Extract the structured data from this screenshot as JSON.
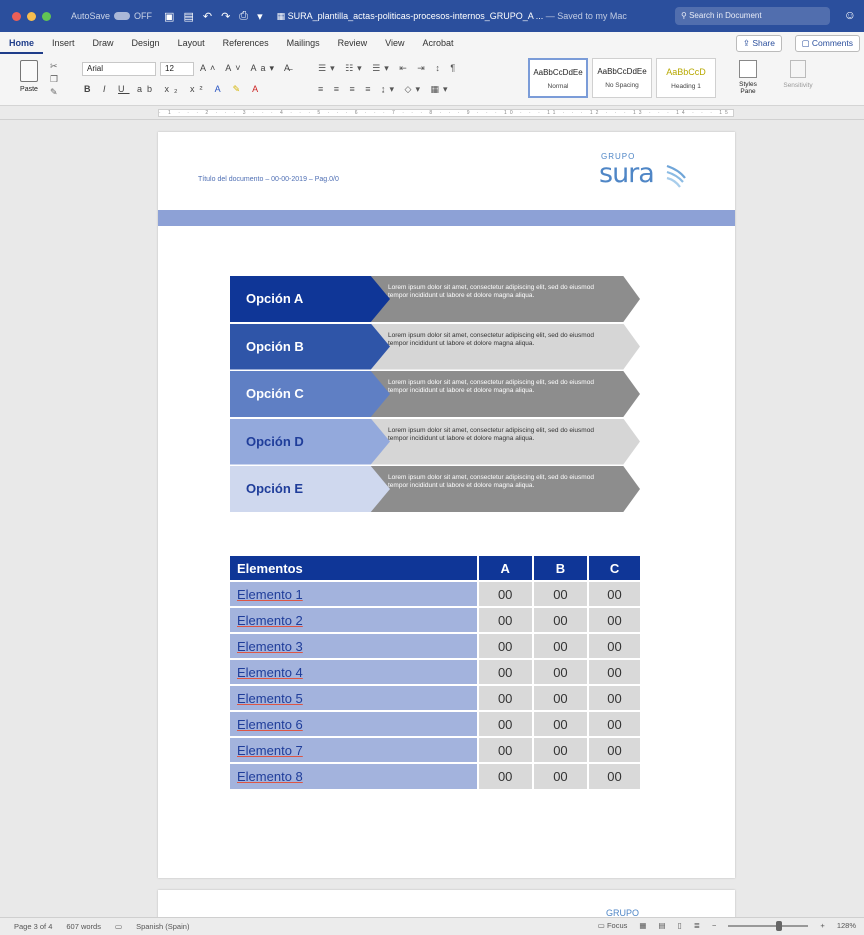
{
  "app": {
    "autosave_label": "AutoSave",
    "autosave_state": "OFF",
    "doc_title": "SURA_plantilla_actas-politicas-procesos-internos_GRUPO_A",
    "saved_status": "— Saved to my Mac",
    "search_placeholder": "Search in Document"
  },
  "tabs": [
    "Home",
    "Insert",
    "Draw",
    "Design",
    "Layout",
    "References",
    "Mailings",
    "Review",
    "View",
    "Acrobat"
  ],
  "share_label": "Share",
  "comments_label": "Comments",
  "ribbon": {
    "paste_label": "Paste",
    "font_name": "Arial",
    "font_size": "12",
    "styles": [
      {
        "sample": "AaBbCcDdEe",
        "name": "Normal"
      },
      {
        "sample": "AaBbCcDdEe",
        "name": "No Spacing"
      },
      {
        "sample": "AaBbCcD",
        "name": "Heading 1"
      }
    ],
    "styles_pane_label": "Styles Pane",
    "sensitivity_label": "Sensitivity"
  },
  "document": {
    "header_text": "Título del documento – 00-00-2019 – Pag.0/0",
    "logo_grupo": "GRUPO",
    "logo_sura": "sura",
    "options": [
      {
        "label": "Opción A",
        "text": "Lorem ipsum dolor sit amet, consectetur adipiscing elit, sed do eiusmod tempor incididunt ut labore et dolore magna aliqua.",
        "label_color": "#0f3697",
        "text_bg": "#8d8d8d",
        "text_light": false
      },
      {
        "label": "Opción B",
        "text": "Lorem ipsum dolor sit amet, consectetur adipiscing elit, sed do eiusmod tempor incididunt ut labore et dolore magna aliqua.",
        "label_color": "#2f55a8",
        "text_bg": "#d6d6d6",
        "text_light": true
      },
      {
        "label": "Opción C",
        "text": "Lorem ipsum dolor sit amet, consectetur adipiscing elit, sed do eiusmod tempor incididunt ut labore et dolore magna aliqua.",
        "label_color": "#5f7fc4",
        "text_bg": "#8d8d8d",
        "text_light": false
      },
      {
        "label": "Opción D",
        "text": "Lorem ipsum dolor sit amet, consectetur adipiscing elit, sed do eiusmod tempor incididunt ut labore et dolore magna aliqua.",
        "label_color": "#93a9dc",
        "text_bg": "#d6d6d6",
        "text_light": true
      },
      {
        "label": "Opción E",
        "text": "Lorem ipsum dolor sit amet, consectetur adipiscing elit, sed do eiusmod tempor incididunt ut labore et dolore magna aliqua.",
        "label_color": "#cfd8ee",
        "text_bg": "#8d8d8d",
        "text_light": false
      }
    ],
    "table": {
      "headers": [
        "Elementos",
        "A",
        "B",
        "C"
      ],
      "rows": [
        [
          "Elemento 1",
          "00",
          "00",
          "00"
        ],
        [
          "Elemento 2",
          "00",
          "00",
          "00"
        ],
        [
          "Elemento 3",
          "00",
          "00",
          "00"
        ],
        [
          "Elemento 4",
          "00",
          "00",
          "00"
        ],
        [
          "Elemento 5",
          "00",
          "00",
          "00"
        ],
        [
          "Elemento 6",
          "00",
          "00",
          "00"
        ],
        [
          "Elemento 7",
          "00",
          "00",
          "00"
        ],
        [
          "Elemento 8",
          "00",
          "00",
          "00"
        ]
      ]
    },
    "next_page_logo": "GRUPO"
  },
  "status": {
    "page": "Page 3 of 4",
    "words": "607 words",
    "language": "Spanish (Spain)",
    "focus_label": "Focus",
    "zoom": "128%"
  }
}
